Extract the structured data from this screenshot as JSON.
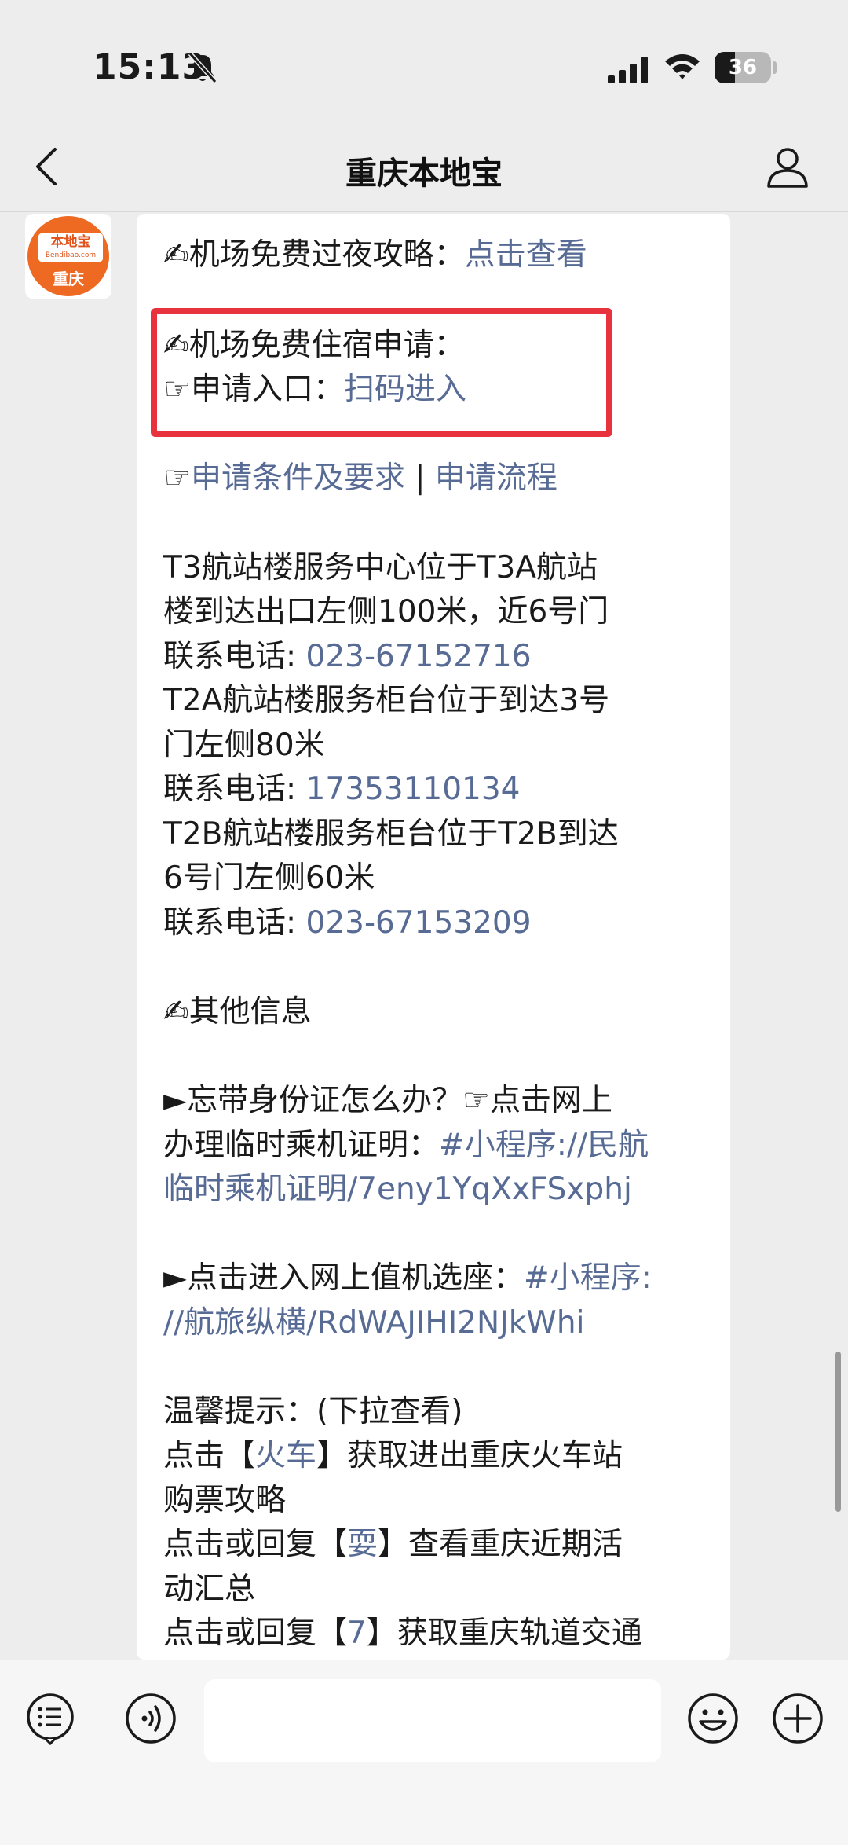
{
  "status_bar": {
    "time": "15:13",
    "battery_percent": 36,
    "battery_label": "36",
    "icons": [
      "bell-mute-icon",
      "cellular-signal-icon",
      "wifi-icon",
      "battery-icon"
    ]
  },
  "nav": {
    "title": "重庆本地宝",
    "icons": [
      "chevron-left-icon",
      "person-icon"
    ]
  },
  "avatar": {
    "brand": "本地宝",
    "domain": "Bendibao.com",
    "city": "重庆"
  },
  "message": {
    "l1_text": "✍机场免费过夜攻略：",
    "l1_link": "点击查看",
    "l2_text": "✍机场免费住宿申请：",
    "l3_text": "☞申请入口：",
    "l3_link": "扫码进入",
    "l4_prefix": "☞",
    "l4_link1": "申请条件及要求",
    "l4_sep": " | ",
    "l4_link2": "申请流程",
    "l5": "T3航站楼服务中心位于T3A航站",
    "l6": "楼到达出口左侧100米，近6号门",
    "l7_label": "联系电话: ",
    "l7_phone": "023-67152716",
    "l8": "T2A航站楼服务柜台位于到达3号",
    "l9": "门左侧80米",
    "l10_label": "联系电话: ",
    "l10_phone": "17353110134",
    "l11": "T2B航站楼服务柜台位于T2B到达",
    "l12": "6号门左侧60米",
    "l13_label": "联系电话: ",
    "l13_phone": "023-67153209",
    "l14": "✍其他信息",
    "l15": "►忘带身份证怎么办？☞点击网上",
    "l16_text": "办理临时乘机证明：",
    "l16_link": "#小程序://民航",
    "l17_link": "临时乘机证明/7eny1YqXxFSxphj",
    "l18_text": "►点击进入网上值机选座：",
    "l18_link": "#小程序:",
    "l19_link": "//航旅纵横/RdWAJIHI2NJkWhi",
    "l20": "温馨提示：(下拉查看)",
    "l21_a": "点击【",
    "l21_link": "火车",
    "l21_b": "】获取进出重庆火车站",
    "l22": "购票攻略",
    "l23_a": "点击或回复【",
    "l23_link": "耍",
    "l23_b": "】查看重庆近期活",
    "l24": "动汇总",
    "l25_a": "点击或回复【",
    "l25_link": "7",
    "l25_b": "】获取重庆轨道交通"
  },
  "input_bar": {
    "icons": [
      "menu-list-icon",
      "voice-icon",
      "emoji-icon",
      "plus-icon"
    ],
    "input_value": ""
  },
  "colors": {
    "link": "#576b95",
    "highlight_border": "#e8333f",
    "avatar_orange": "#ee6a22",
    "background": "#ededed"
  }
}
